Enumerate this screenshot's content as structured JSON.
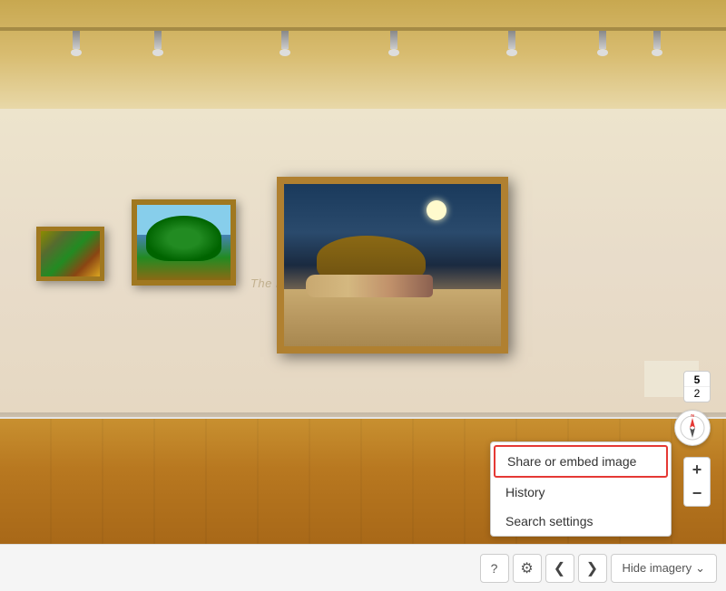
{
  "gallery": {
    "name": "The Marjorie T. and Sid R. Bass Gallery",
    "background_color": "#e8d8b0"
  },
  "number_badge": {
    "line1": "5",
    "line2": "2"
  },
  "context_menu": {
    "items": [
      {
        "id": "share-embed",
        "label": "Share or embed image",
        "highlighted": true
      },
      {
        "id": "history",
        "label": "History",
        "highlighted": false
      },
      {
        "id": "search-settings",
        "label": "Search settings",
        "highlighted": false
      }
    ]
  },
  "toolbar": {
    "help_label": "?",
    "settings_label": "⚙",
    "nav_prev_label": "❮",
    "nav_next_label": "❯",
    "hide_imagery_label": "Hide imagery",
    "hide_imagery_chevron": "⌄"
  },
  "zoom": {
    "plus_label": "+",
    "minus_label": "−"
  },
  "compass": {
    "label": "compass-icon"
  }
}
